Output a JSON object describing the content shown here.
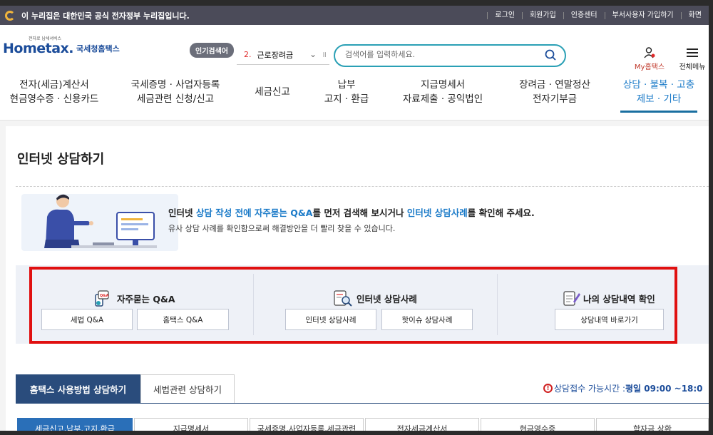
{
  "gov_bar": {
    "notice": "이 누리집은 대한민국 공식 전자정부 누리집입니다.",
    "links": [
      "로그인",
      "회원가입",
      "인증센터",
      "부서사용자 가입하기",
      "화면"
    ]
  },
  "header": {
    "logo_main": "Hometax.",
    "logo_sub": "국세청홈택스",
    "logo_tiny": "전자로 납세서비스",
    "hot_label": "인기검색어",
    "hot_rank": "2.",
    "hot_keyword": "근로장려금",
    "search_placeholder": "검색어를 입력하세요.",
    "my_label": "My홈택스",
    "all_menu_label": "전체메뉴"
  },
  "nav": {
    "items": [
      {
        "line1": "전자(세금)계산서",
        "line2": "현금영수증 · 신용카드"
      },
      {
        "line1": "국세증명 · 사업자등록",
        "line2": "세금관련 신청/신고"
      },
      {
        "line1": "세금신고",
        "line2": ""
      },
      {
        "line1": "납부",
        "line2": "고지 · 환급"
      },
      {
        "line1": "지급명세서",
        "line2": "자료제출 · 공익법인"
      },
      {
        "line1": "장려금 · 연말정산",
        "line2": "전자기부금"
      },
      {
        "line1": "상담 · 불복 · 고충",
        "line2": "제보 · 기타"
      }
    ]
  },
  "page": {
    "title": "인터넷 상담하기"
  },
  "guide": {
    "line1_a": "인터넷 ",
    "line1_b": "상담 작성 전에 자주묻는 Q&A",
    "line1_c": "를 먼저 검색해 보시거나 ",
    "line1_d": "인터넷 상담사례",
    "line1_e": "를 확인해 주세요.",
    "line2": "유사 상담 사례를 확인함으로써 해결방안을 더 빨리 찾을 수 있습니다."
  },
  "cards": [
    {
      "title": "자주묻는 Q&A",
      "buttons": [
        "세법 Q&A",
        "홈택스 Q&A"
      ]
    },
    {
      "title": "인터넷 상담사례",
      "buttons": [
        "인터넷 상담사례",
        "핫이슈 상담사례"
      ]
    },
    {
      "title": "나의 상담내역 확인",
      "buttons": [
        "상담내역 바로가기"
      ]
    }
  ],
  "tabs": {
    "active": "홈택스 사용방법 상담하기",
    "other": "세법관련 상담하기"
  },
  "hours": {
    "warn_icon": "!",
    "label": "상담접수 가능시간 : ",
    "time": "평일 09:00 ~18:0"
  },
  "subtabs": [
    "세금신고,납부,고지,환급",
    "지급명세서",
    "국세증명,사업자등록,세금관련",
    "전자세금계산서",
    "현금영수증",
    "학자금 상환"
  ],
  "colors": {
    "brand_blue": "#1b4c9a",
    "accent_cyan": "#2aa0b5",
    "tab_navy": "#2a4c7c",
    "highlight_red": "#e01010"
  }
}
